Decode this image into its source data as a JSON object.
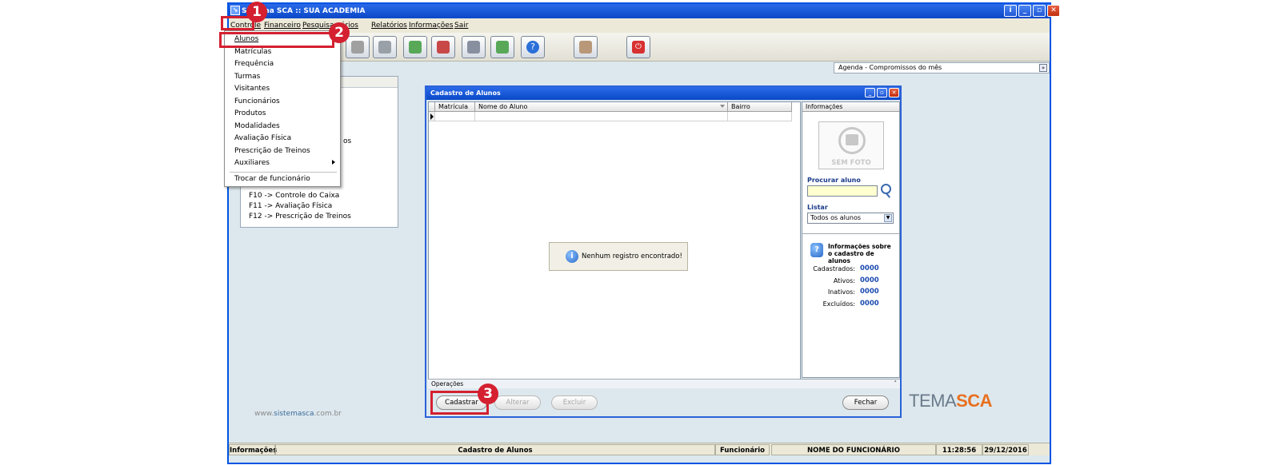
{
  "app": {
    "title": "Sistema SCA :: SUA ACADEMIA",
    "menu": [
      "Controle",
      "Financeiro",
      "Pesquisa",
      "Relatórios",
      "Relatórios",
      "Informações",
      "Sair"
    ],
    "agenda_label": "Agenda - Compromissos do mês",
    "shortcuts": [
      "F10 -> Controle do Caixa",
      "F11 -> Avaliação Física",
      "F12 -> Prescrição de Treinos"
    ],
    "shortcut_partial": "os",
    "website": {
      "prefix": "www.",
      "brand": "sistemasca",
      "suffix": ".com.br"
    },
    "logo": {
      "prefix": "TEMA",
      "brand": "SCA"
    },
    "status": {
      "info_label": "Informações",
      "screen": "Cadastro de Alunos",
      "employee_label": "Funcionário",
      "employee_name": "NOME DO FUNCIONÁRIO",
      "time": "11:28:56",
      "date": "29/12/2016"
    }
  },
  "controle_menu": [
    "Alunos",
    "Matrículas",
    "Frequência",
    "Turmas",
    "Visitantes",
    "Funcionários",
    "Produtos",
    "Modalidades",
    "Avaliação Física",
    "Prescrição de Treinos",
    "Auxiliares",
    "Trocar de funcionário"
  ],
  "badges": [
    "1",
    "2",
    "3"
  ],
  "dialog": {
    "title": "Cadastro de Alunos",
    "columns": [
      "Matrícula",
      "Nome do Aluno",
      "Bairro"
    ],
    "empty_message": "Nenhum registro encontrado!",
    "side_header": "Informações",
    "photo_text": "SEM FOTO",
    "search_label": "Procurar aluno",
    "list_label": "Listar",
    "list_value": "Todos os alunos",
    "info_title": "Informações sobre o cadastro de alunos",
    "stats": [
      {
        "label": "Cadastrados:",
        "value": "0000"
      },
      {
        "label": "Ativos:",
        "value": "0000"
      },
      {
        "label": "Inativos:",
        "value": "0000"
      },
      {
        "label": "Excluídos:",
        "value": "0000"
      }
    ],
    "ops_label": "Operações",
    "buttons": {
      "cadastrar": "Cadastrar",
      "alterar": "Alterar",
      "excluir": "Excluir",
      "fechar": "Fechar"
    }
  },
  "colors": {
    "highlight": "#d42030",
    "titlebar": "#0a48c8",
    "stat_value": "#1a4ab0",
    "brand_orange": "#e87020"
  }
}
